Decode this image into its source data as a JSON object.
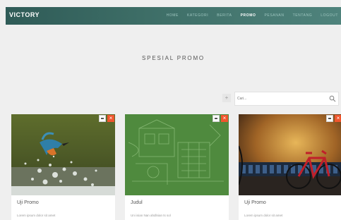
{
  "navbar": {
    "brand": "VICTORY",
    "items": [
      {
        "label": "HOME",
        "active": false
      },
      {
        "label": "KATEGORI",
        "active": false
      },
      {
        "label": "BERITA",
        "active": false
      },
      {
        "label": "PROMO",
        "active": true
      },
      {
        "label": "PESANAN",
        "active": false
      },
      {
        "label": "TENTANG",
        "active": false
      },
      {
        "label": "LOGOUT",
        "active": false
      }
    ]
  },
  "hero": {
    "title": "SPESIAL PROMO"
  },
  "toolbar": {
    "add_label": "+",
    "search_placeholder": "Cari...",
    "search_icon": "search-icon"
  },
  "cards": [
    {
      "title": "Uji Promo",
      "desc": "Lorem ipsum dolor sit amet",
      "image": "kingfisher-photo"
    },
    {
      "title": "Judul",
      "desc": "Uni isian Nan ahdlnian ts sol",
      "image": "green-sketch-photo"
    },
    {
      "title": "Uji Promo",
      "desc": "Lorem ipsum dolor sit amet",
      "image": "red-bicycle-photo"
    }
  ],
  "colors": {
    "navbar": "#3d6d66",
    "close_button": "#f0562e",
    "background": "#efefef"
  }
}
